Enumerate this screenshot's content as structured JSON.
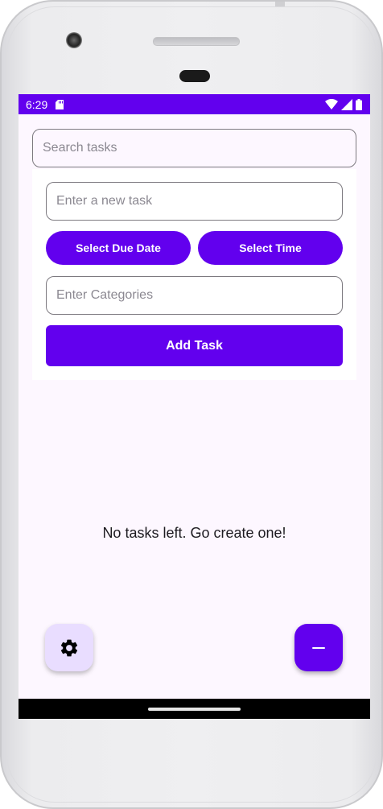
{
  "status_bar": {
    "time": "6:29"
  },
  "search": {
    "placeholder": "Search tasks"
  },
  "task_form": {
    "task_placeholder": "Enter a new task",
    "due_date_label": "Select Due Date",
    "time_label": "Select Time",
    "categories_placeholder": "Enter Categories",
    "add_label": "Add Task"
  },
  "empty_state": {
    "message": "No tasks left. Go create one!"
  },
  "fabs": {
    "settings_icon": "gear-icon",
    "minus_icon": "minus-icon"
  },
  "colors": {
    "primary": "#6200ee",
    "background": "#fdf7ff",
    "settings_fab": "#e9ddff"
  }
}
